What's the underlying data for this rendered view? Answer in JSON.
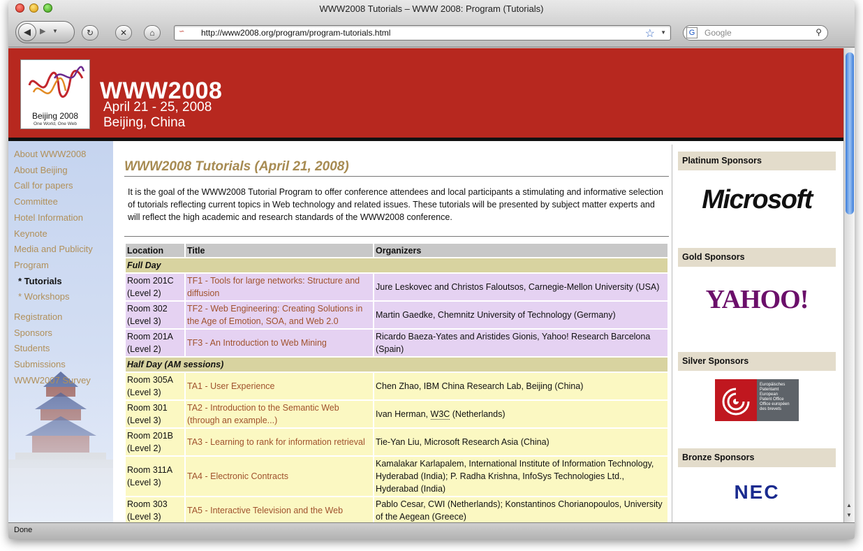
{
  "browser": {
    "window_title": "WWW2008 Tutorials – WWW 2008: Program (Tutorials)",
    "url": "http://www2008.org/program/program-tutorials.html",
    "search_placeholder": "Google",
    "status": "Done",
    "search_engine_glyph": "G"
  },
  "header": {
    "site_title": "WWW2008",
    "dates": "April 21 - 25, 2008",
    "location": "Beijing, China",
    "logo_city": "Beijing 2008",
    "logo_slogan": "One World, One Web",
    "bg_color": "#b7281f"
  },
  "nav": {
    "items": [
      {
        "label": "About WWW2008"
      },
      {
        "label": "About Beijing"
      },
      {
        "label": "Call for papers"
      },
      {
        "label": "Committee"
      },
      {
        "label": "Hotel Information"
      },
      {
        "label": "Keynote"
      },
      {
        "label": "Media and Publicity"
      },
      {
        "label": "Program"
      },
      {
        "label": "* Tutorials"
      },
      {
        "label": "* Workshops"
      },
      {
        "label": "Registration"
      },
      {
        "label": "Sponsors"
      },
      {
        "label": "Students"
      },
      {
        "label": "Submissions"
      },
      {
        "label": "WWW2007 Survey"
      }
    ]
  },
  "main": {
    "title": "WWW2008 Tutorials (April 21, 2008)",
    "intro": "It is the goal of the WWW2008 Tutorial Program to offer conference attendees and local participants a stimulating and informative selection of tutorials reflecting current topics in Web technology and related issues. These tutorials will be presented by subject matter experts and will reflect the high academic and research standards of the WWW2008 conference.",
    "columns": [
      "Location",
      "Title",
      "Organizers"
    ],
    "sections": [
      {
        "label": "Full Day",
        "rows": [
          {
            "location": "Room 201C (Level 2)",
            "title": "TF1 - Tools for large networks: Structure and diffusion",
            "organizers": "Jure Leskovec and Christos Faloutsos, Carnegie-Mellon University (USA)"
          },
          {
            "location": "Room 302 (Level 3)",
            "title": "TF2 - Web Engineering: Creating Solutions in the Age of Emotion, SOA, and Web 2.0",
            "organizers": "Martin Gaedke, Chemnitz University of Technology (Germany)"
          },
          {
            "location": "Room 201A (Level 2)",
            "title": "TF3 - An Introduction to Web Mining",
            "organizers": "Ricardo Baeza-Yates and Aristides Gionis, Yahoo! Research Barcelona (Spain)"
          }
        ]
      },
      {
        "label": "Half Day (AM sessions)",
        "rows": [
          {
            "location": "Room 305A (Level 3)",
            "title": "TA1 - User Experience",
            "organizers": "Chen Zhao, IBM China Research Lab, Beijing (China)"
          },
          {
            "location": "Room 301 (Level 3)",
            "title": "TA2 - Introduction to the Semantic Web (through an example...)",
            "organizers_pre": "Ivan Herman, ",
            "organizers_abbr": "W3C",
            "organizers_post": " (Netherlands)"
          },
          {
            "location": "Room 201B (Level 2)",
            "title": "TA3 - Learning to rank for information retrieval",
            "organizers": "Tie-Yan Liu, Microsoft Research Asia (China)"
          },
          {
            "location": "Room 311A (Level 3)",
            "title": "TA4 - Electronic Contracts",
            "organizers": "Kamalakar Karlapalem, International Institute of Information Technology, Hyderabad (India); P. Radha Krishna, InfoSys Technologies Ltd., Hyderabad (India)"
          },
          {
            "location": "Room 303 (Level 3)",
            "title": "TA5 - Interactive Television and the Web",
            "organizers": "Pablo Cesar, CWI (Netherlands); Konstantinos Chorianopoulos, University of the Aegean (Greece)"
          }
        ]
      }
    ]
  },
  "sponsors": {
    "platinum": {
      "label": "Platinum Sponsors",
      "logo_text": "Microsoft"
    },
    "gold": {
      "label": "Gold Sponsors",
      "logo_text": "YAHOO!"
    },
    "silver": {
      "label": "Silver Sponsors",
      "logo_text": "Europäisches\nPatentamt\nEuropean\nPatent Office\nOffice européen\ndes brevets"
    },
    "bronze": {
      "label": "Bronze Sponsors",
      "logo_text": "NEC"
    }
  },
  "colors": {
    "nav_link": "#b1905a",
    "title_gold": "#a78b52",
    "full_day_row": "#e5d2f2",
    "half_day_row": "#fbf8c2",
    "section_row": "#d8d3a0",
    "link": "#a0522d"
  }
}
